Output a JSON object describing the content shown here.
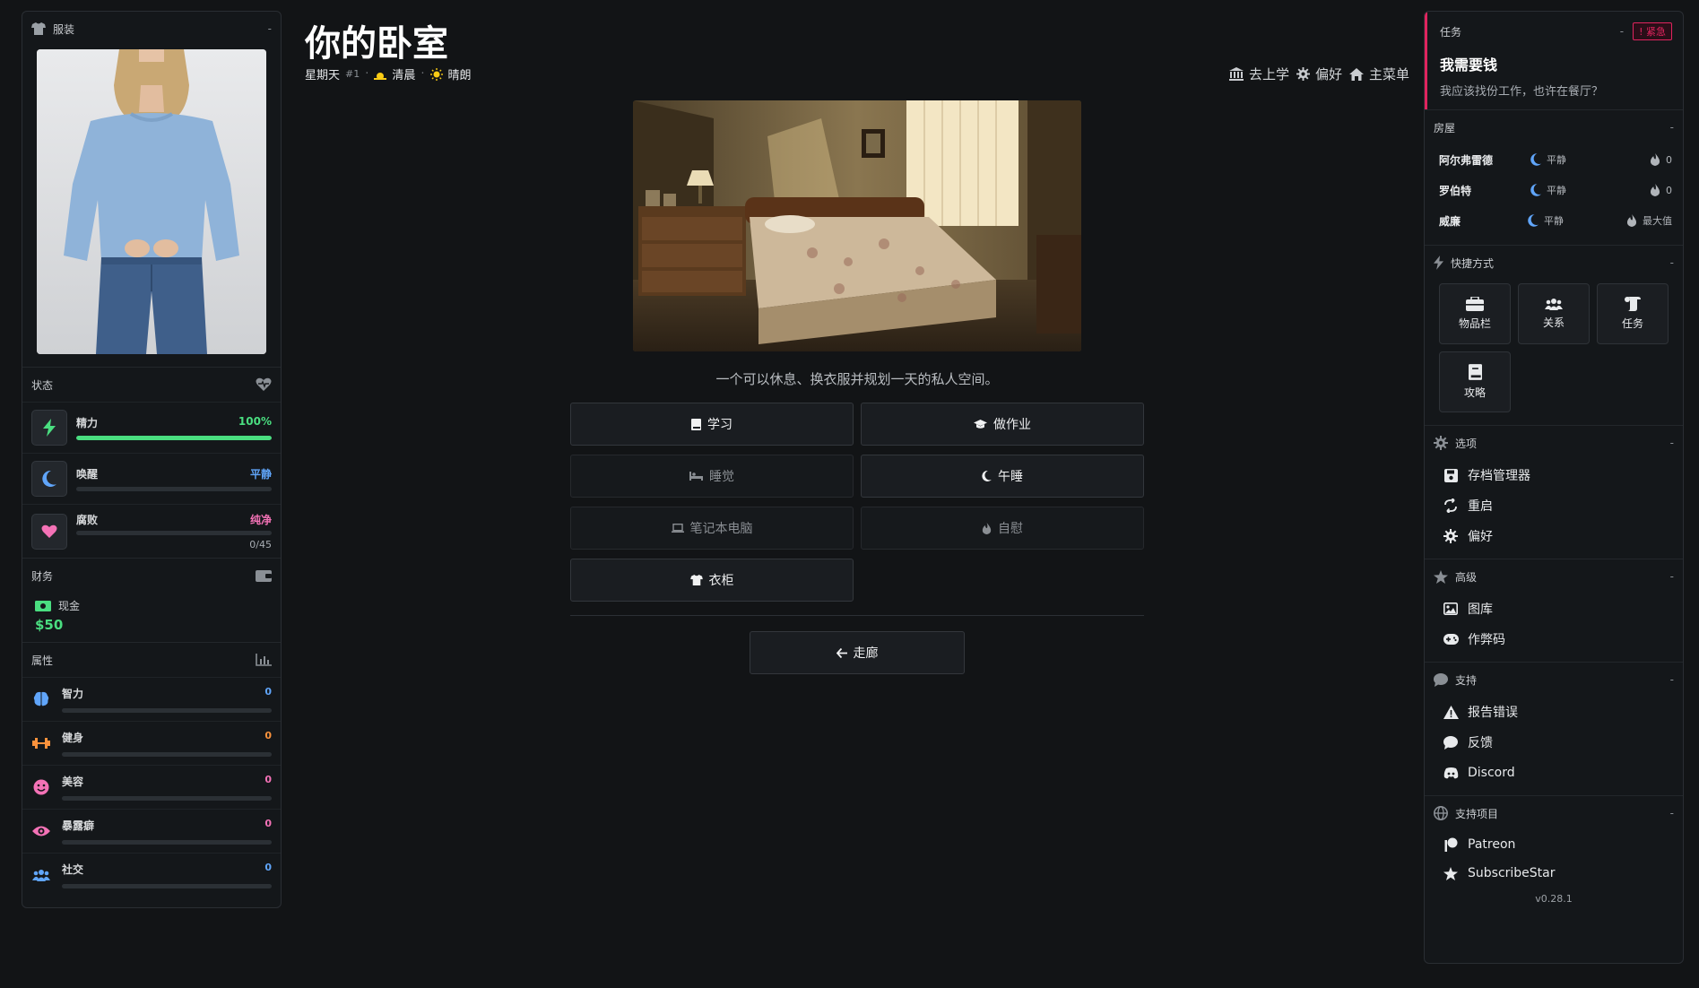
{
  "left": {
    "outfit": {
      "title": "服装",
      "collapse": "-"
    },
    "status": {
      "title": "状态",
      "stats": [
        {
          "label": "精力",
          "value": "100%",
          "color": "#4ade80",
          "fill": 1.0
        },
        {
          "label": "唤醒",
          "value": "平静",
          "color": "#60a5fa",
          "fill": 0.0
        },
        {
          "label": "腐败",
          "value": "纯净",
          "color": "#f472b6",
          "fill": 0.0,
          "sub": "0/45"
        }
      ]
    },
    "finance": {
      "title": "财务",
      "cash_label": "现金",
      "cash_value": "$50"
    },
    "attributes": {
      "title": "属性",
      "items": [
        {
          "label": "智力",
          "value": "0",
          "color": "#60a5fa",
          "icon": "brain-icon"
        },
        {
          "label": "健身",
          "value": "0",
          "color": "#fb923c",
          "icon": "dumbbell-icon"
        },
        {
          "label": "美容",
          "value": "0",
          "color": "#f472b6",
          "icon": "smile-icon"
        },
        {
          "label": "暴露癖",
          "value": "0",
          "color": "#f472b6",
          "icon": "eye-icon"
        },
        {
          "label": "社交",
          "value": "0",
          "color": "#60a5fa",
          "icon": "users-icon"
        }
      ]
    }
  },
  "header": {
    "title": "你的卧室",
    "day": "星期天",
    "day_num": "#1",
    "time_of_day": "清晨",
    "weather": "晴朗",
    "nav": {
      "school": "去上学",
      "prefs": "偏好",
      "main_menu": "主菜单"
    }
  },
  "main": {
    "description": "一个可以休息、换衣服并规划一天的私人空间。",
    "actions": {
      "study": "学习",
      "homework": "做作业",
      "sleep": "睡觉",
      "nap": "午睡",
      "laptop": "笔记本电脑",
      "self": "自慰",
      "wardrobe": "衣柜"
    },
    "back": "走廊"
  },
  "right": {
    "quest": {
      "header": "任务",
      "collapse": "-",
      "urgent": "紧急",
      "title": "我需要钱",
      "text": "我应该找份工作，也许在餐厅？"
    },
    "houses": {
      "title": "房屋",
      "rows": [
        {
          "name": "阿尔弗雷德",
          "mood": "平静",
          "lust": "0"
        },
        {
          "name": "罗伯特",
          "mood": "平静",
          "lust": "0"
        },
        {
          "name": "威廉",
          "mood": "平静",
          "lust": "最大值"
        }
      ]
    },
    "shortcuts": {
      "title": "快捷方式",
      "items": [
        "物品栏",
        "关系",
        "任务",
        "攻略"
      ]
    },
    "options": {
      "title": "选项",
      "items": [
        "存档管理器",
        "重启",
        "偏好"
      ]
    },
    "advanced": {
      "title": "高级",
      "items": [
        "图库",
        "作弊码"
      ]
    },
    "support": {
      "title": "支持",
      "items": [
        "报告错误",
        "反馈",
        "Discord"
      ]
    },
    "support_project": {
      "title": "支持项目",
      "items": [
        "Patreon",
        "SubscribeStar"
      ]
    },
    "version": "v0.28.1"
  }
}
